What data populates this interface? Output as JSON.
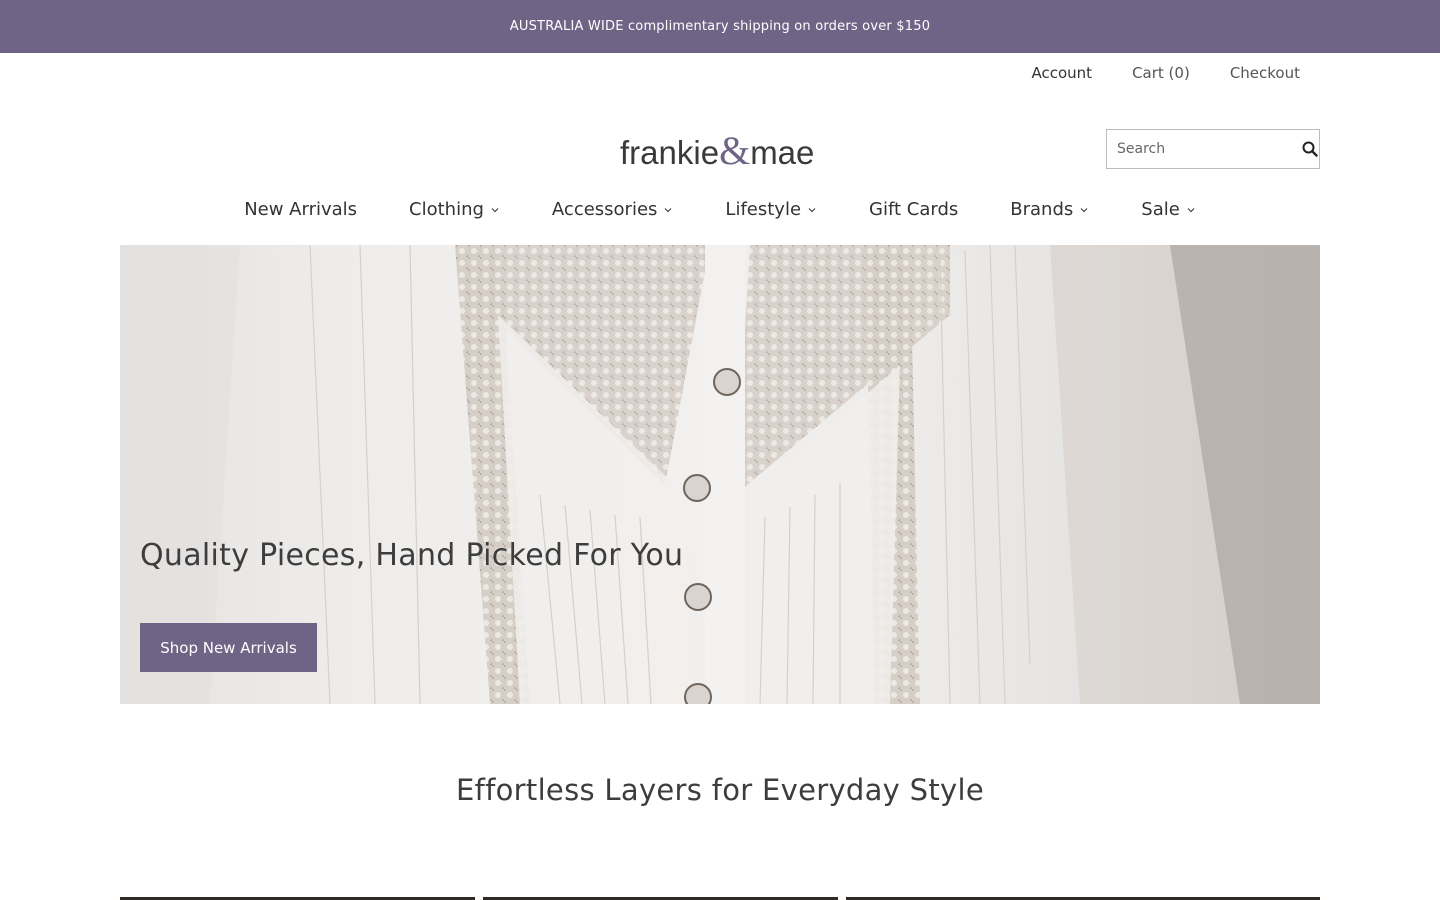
{
  "announcement": "AUSTRALIA WIDE complimentary shipping on orders over $150",
  "util": {
    "account": "Account",
    "cart": "Cart (0)",
    "checkout": "Checkout"
  },
  "brand": {
    "name": "frankie&mae"
  },
  "search": {
    "placeholder": "Search",
    "icon": "search-icon"
  },
  "nav": [
    {
      "label": "New Arrivals",
      "dropdown": false
    },
    {
      "label": "Clothing",
      "dropdown": true
    },
    {
      "label": "Accessories",
      "dropdown": true
    },
    {
      "label": "Lifestyle",
      "dropdown": true
    },
    {
      "label": "Gift Cards",
      "dropdown": false
    },
    {
      "label": "Brands",
      "dropdown": true
    },
    {
      "label": "Sale",
      "dropdown": true
    }
  ],
  "hero": {
    "heading": "Quality Pieces, Hand Picked For You",
    "button": "Shop New Arrivals"
  },
  "section": {
    "title": "Effortless Layers for Everyday Style"
  },
  "colors": {
    "accent": "#6f6485",
    "text": "#333333"
  }
}
